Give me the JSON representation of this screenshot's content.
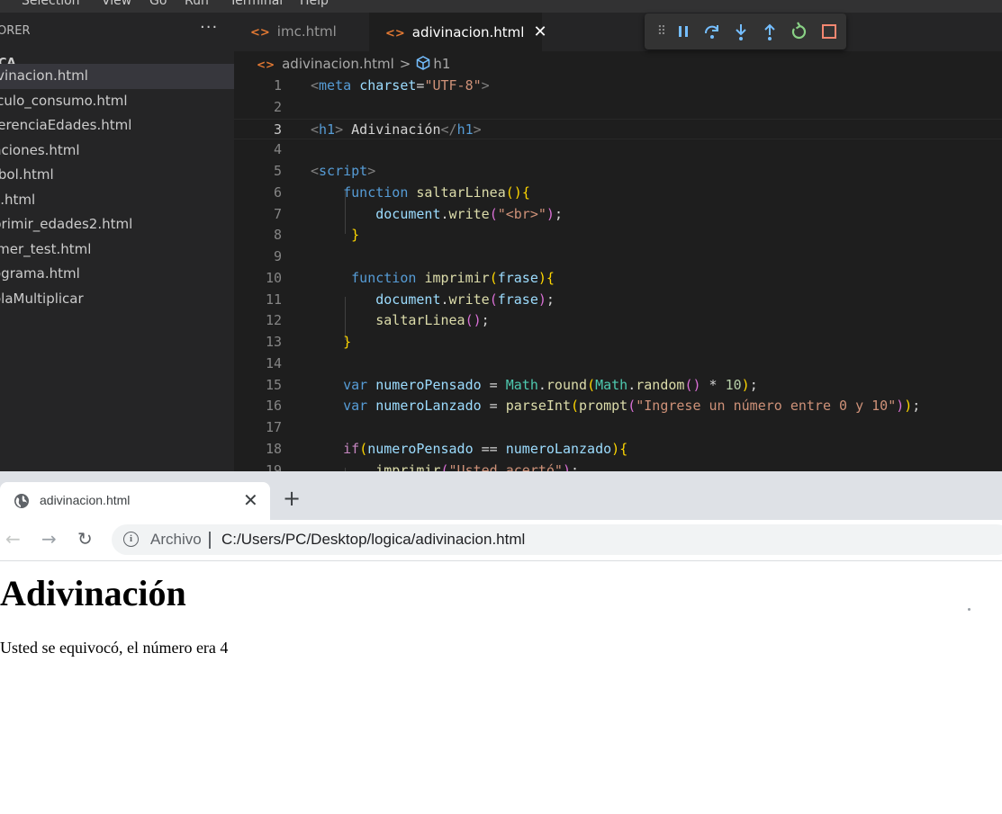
{
  "vscode": {
    "menu": [
      "Selection",
      "View",
      "Go",
      "Run",
      "Terminal",
      "Help"
    ],
    "explorer": {
      "title": "ORER",
      "more": "···",
      "folder": "CA",
      "files": [
        "ivinacion.html",
        "lculo_consumo.html",
        "ferenciaEdades.html",
        "nciones.html",
        "tbol.html",
        "c.html",
        "primir_edades2.html",
        "imer_test.html",
        "ograma.html",
        "olaMultiplicar"
      ]
    },
    "tabs": [
      {
        "label": "imc.html",
        "icon": "<>"
      },
      {
        "label": "adivinacion.html",
        "icon": "<>",
        "close": "✕"
      }
    ],
    "debug_toolbar": {
      "icons": [
        "grip-icon",
        "pause-icon",
        "step-over-icon",
        "step-into-icon",
        "step-out-icon",
        "restart-icon",
        "stop-icon"
      ],
      "colors": {
        "grip": "#8b8b8b",
        "pause": "#75beff",
        "step": "#75beff",
        "restart": "#89d185",
        "stop": "#f48771"
      }
    },
    "breadcrumb": {
      "icon": "<>",
      "file": "adivinacion.html",
      "separator": ">",
      "symbol": "h1"
    },
    "line_numbers": [
      "1",
      "2",
      "3",
      "4",
      "5",
      "6",
      "7",
      "8",
      "9",
      "10",
      "11",
      "12",
      "13",
      "14",
      "15",
      "16",
      "17",
      "18",
      "19"
    ],
    "code": {
      "l1": {
        "lt": "<",
        "tag": "meta",
        "attr": "charset",
        "eq": "=",
        "val": "\"UTF-8\"",
        "gt": ">"
      },
      "l3": {
        "open_lt": "<",
        "tag": "h1",
        "open_gt": ">",
        "text": " Adivinación",
        "close_lt": "</",
        "close_tag": "h1",
        "close_gt": ">"
      },
      "l5": {
        "lt": "<",
        "tag": "script",
        "gt": ">"
      },
      "l6": {
        "kw": "function",
        "name": "saltarLinea",
        "paren": "()",
        "brace": "{"
      },
      "l7": {
        "obj": "document",
        "dot": ".",
        "fn": "write",
        "lp": "(",
        "str": "\"<br>\"",
        "rp": ")",
        "semi": ";"
      },
      "l8": {
        "brace": "}"
      },
      "l10": {
        "kw": "function",
        "name": "imprimir",
        "lp": "(",
        "param": "frase",
        "rp": ")",
        "brace": "{"
      },
      "l11": {
        "obj": "document",
        "dot": ".",
        "fn": "write",
        "lp": "(",
        "arg": "frase",
        "rp": ")",
        "semi": ";"
      },
      "l12": {
        "fn": "saltarLinea",
        "paren": "()",
        "semi": ";"
      },
      "l13": {
        "brace": "}"
      },
      "l15": {
        "kw": "var",
        "name": "numeroPensado",
        "op": " = ",
        "cls": "Math",
        "dot": ".",
        "fn": "round",
        "lp": "(",
        "cls2": "Math",
        "dot2": ".",
        "fn2": "random",
        "paren2": "()",
        "mul": " * ",
        "num": "10",
        "rp": ")",
        "semi": ";"
      },
      "l16": {
        "kw": "var",
        "name": "numeroLanzado",
        "op": " = ",
        "fn": "parseInt",
        "lp": "(",
        "fn2": "prompt",
        "lp2": "(",
        "str": "\"Ingrese un número entre 0 y 10\"",
        "rp2": ")",
        "rp": ")",
        "semi": ";"
      },
      "l18": {
        "kw": "if",
        "lp": "(",
        "a": "numeroPensado",
        "op": " == ",
        "b": "numeroLanzado",
        "rp": ")",
        "brace": "{"
      },
      "l19": {
        "fn": "imprimir",
        "lp": "(",
        "str": "\"Usted acertó\"",
        "rp": ")",
        "semi": ";"
      }
    }
  },
  "chrome": {
    "tab": {
      "title": "adivinacion.html",
      "close": "✕",
      "icon": "globe-icon"
    },
    "new_tab": "+",
    "nav": {
      "back": "←",
      "forward": "→",
      "reload": "↻"
    },
    "omnibox": {
      "info": "i",
      "chip": "Archivo",
      "url": "C:/Users/PC/Desktop/logica/adivinacion.html"
    },
    "page": {
      "heading": "Adivinación",
      "message": "Usted se equivocó, el número era 4"
    }
  }
}
